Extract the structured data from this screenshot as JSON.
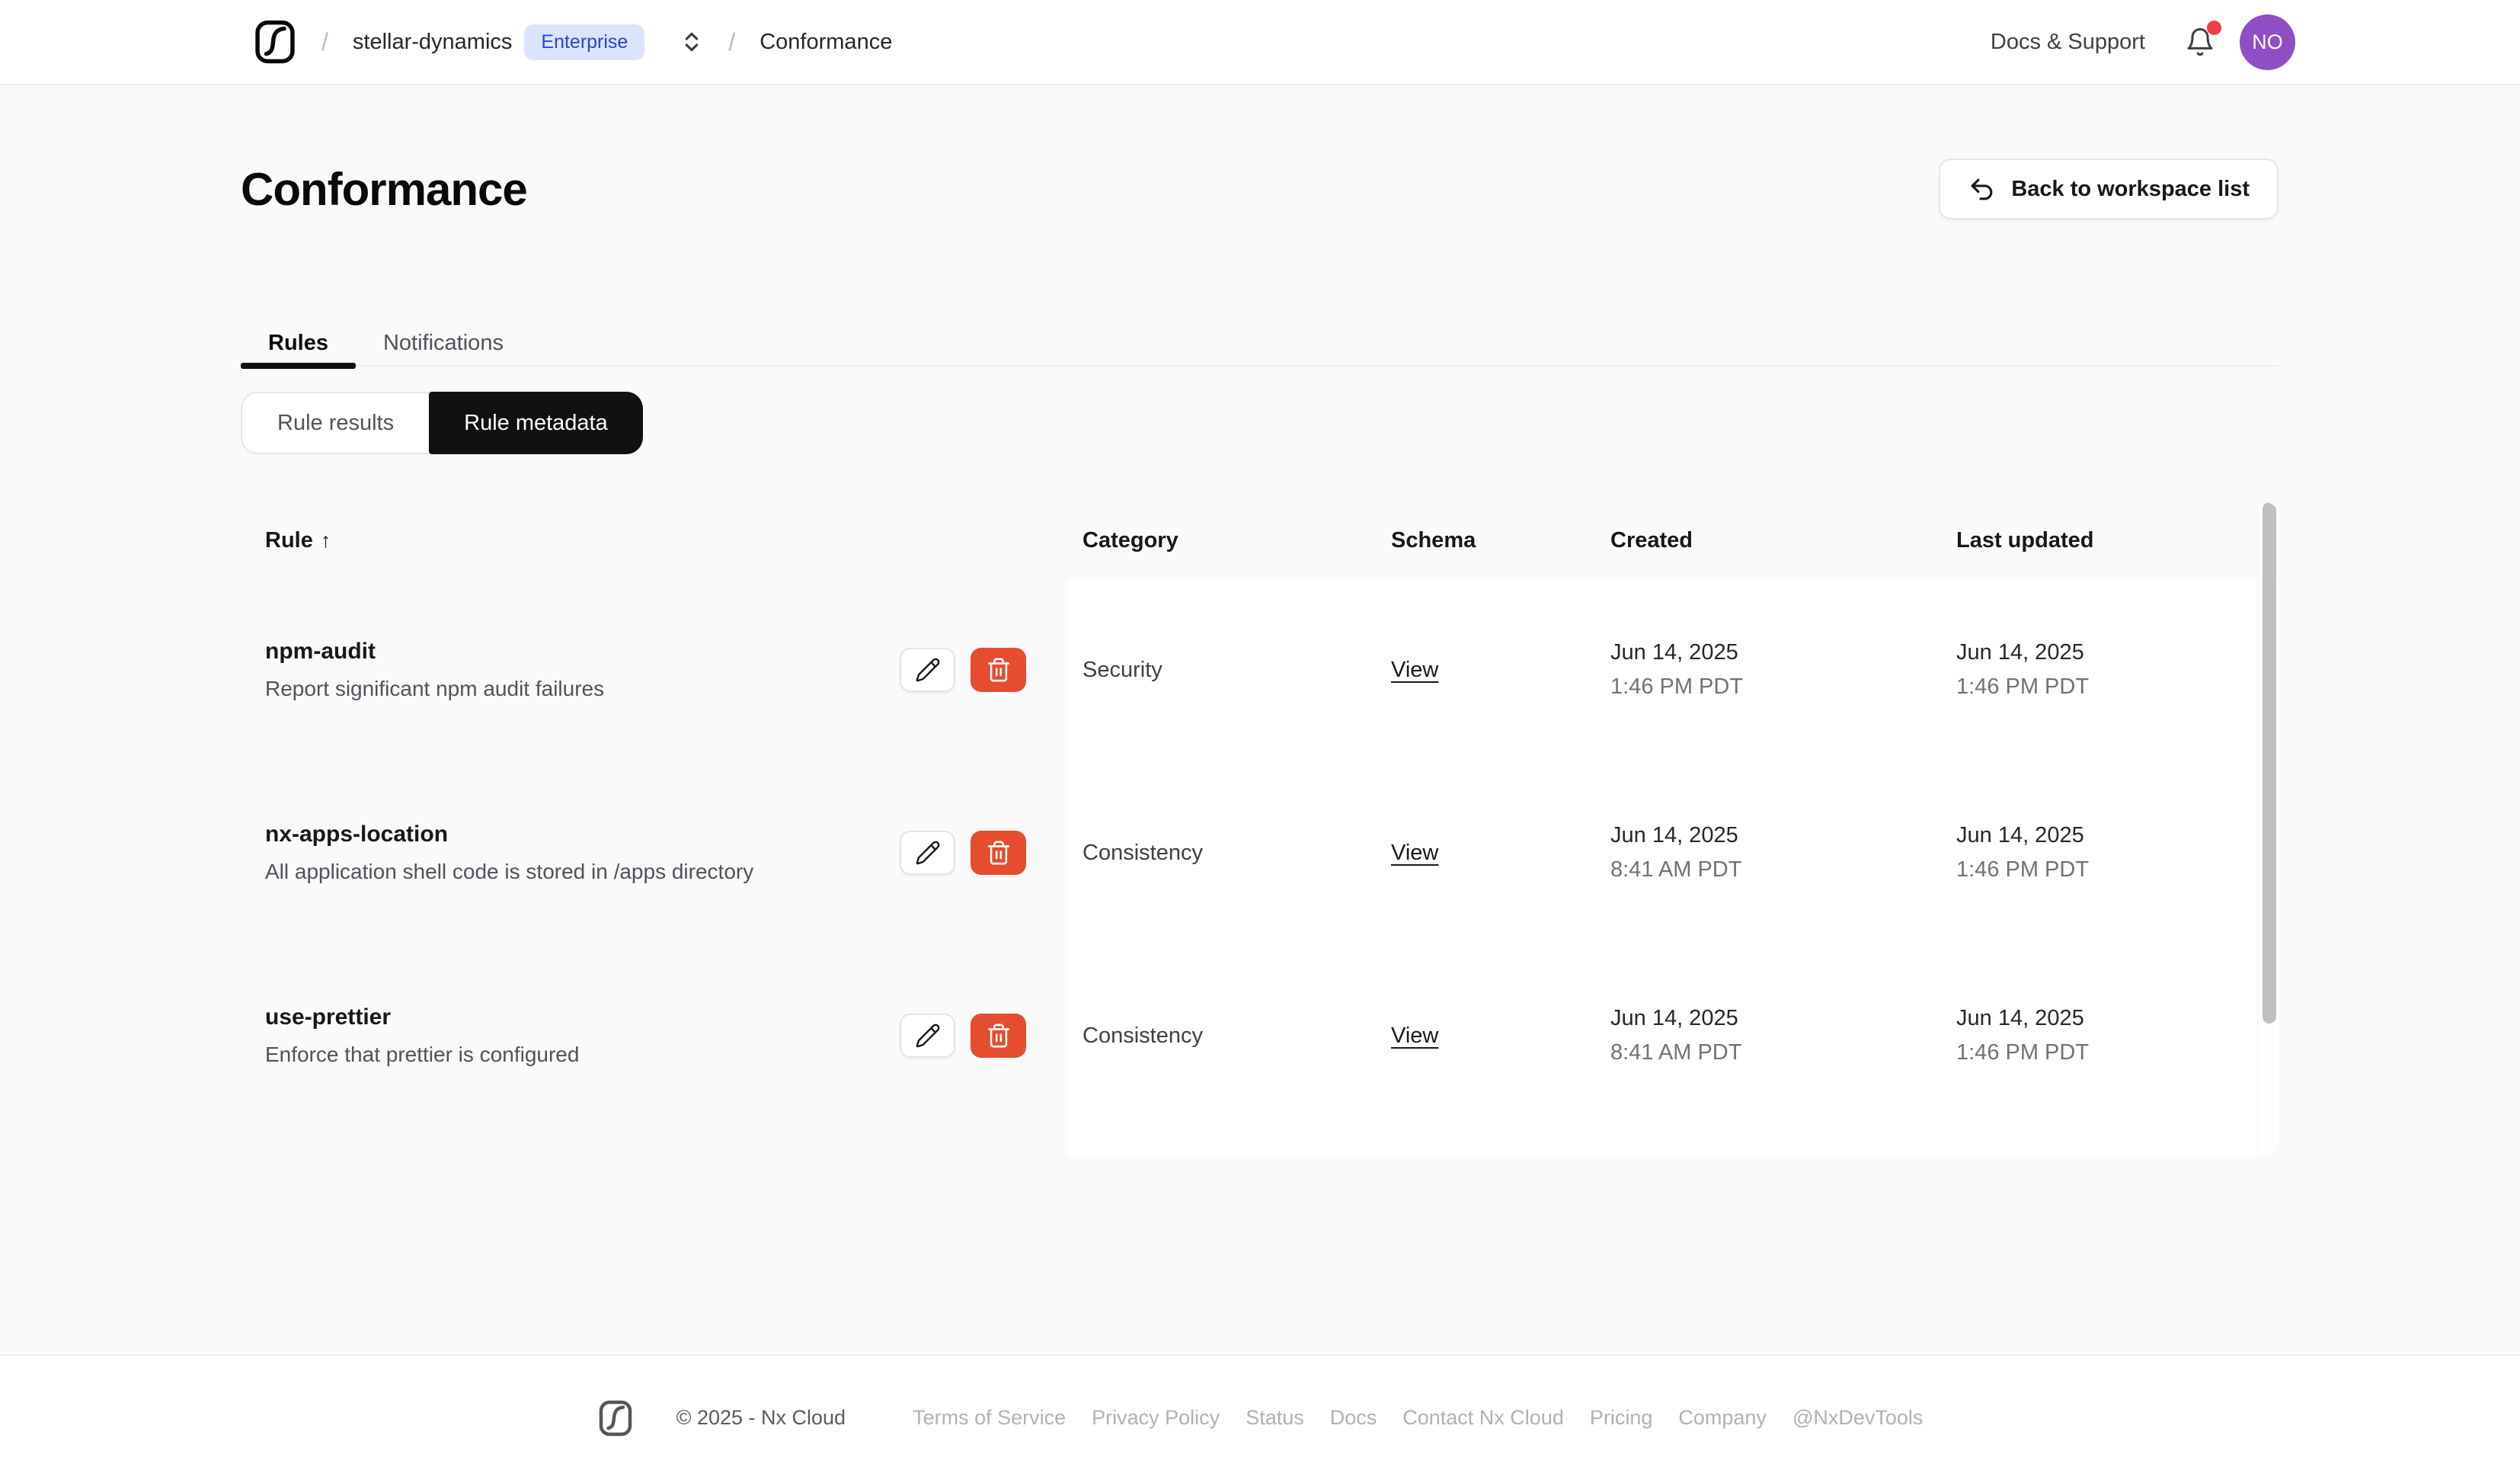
{
  "navbar": {
    "breadcrumb": {
      "separator": "/",
      "org": "stellar-dynamics",
      "badge": "Enterprise",
      "page": "Conformance"
    },
    "docs_support": "Docs & Support",
    "avatar_initials": "NO"
  },
  "page": {
    "title": "Conformance",
    "back_button": "Back to workspace list"
  },
  "tabs": [
    {
      "label": "Rules",
      "active": true
    },
    {
      "label": "Notifications",
      "active": false
    }
  ],
  "segmented": [
    {
      "label": "Rule results",
      "active": false
    },
    {
      "label": "Rule metadata",
      "active": true
    }
  ],
  "table": {
    "columns": [
      "Rule",
      "Category",
      "Schema",
      "Created",
      "Last updated"
    ],
    "sort_column": "Rule",
    "sort_indicator": "↑",
    "rows": [
      {
        "name": "npm-audit",
        "description": "Report significant npm audit failures",
        "category": "Security",
        "schema_label": "View",
        "created_date": "Jun 14, 2025",
        "created_time": "1:46 PM PDT",
        "updated_date": "Jun 14, 2025",
        "updated_time": "1:46 PM PDT"
      },
      {
        "name": "nx-apps-location",
        "description": "All application shell code is stored in /apps directory",
        "category": "Consistency",
        "schema_label": "View",
        "created_date": "Jun 14, 2025",
        "created_time": "8:41 AM PDT",
        "updated_date": "Jun 14, 2025",
        "updated_time": "1:46 PM PDT"
      },
      {
        "name": "use-prettier",
        "description": "Enforce that prettier is configured",
        "category": "Consistency",
        "schema_label": "View",
        "created_date": "Jun 14, 2025",
        "created_time": "8:41 AM PDT",
        "updated_date": "Jun 14, 2025",
        "updated_time": "1:46 PM PDT"
      }
    ]
  },
  "footer": {
    "copyright": "© 2025 - Nx Cloud",
    "links": [
      "Terms of Service",
      "Privacy Policy",
      "Status",
      "Docs",
      "Contact Nx Cloud",
      "Pricing",
      "Company",
      "@NxDevTools"
    ]
  },
  "colors": {
    "accent_blue_bg": "#dbe4fd",
    "accent_blue_text": "#2c43cf",
    "danger": "#e54d2e",
    "avatar_purple": "#8f4ec4",
    "notification_red": "#ee4040",
    "active_black": "#111113"
  }
}
